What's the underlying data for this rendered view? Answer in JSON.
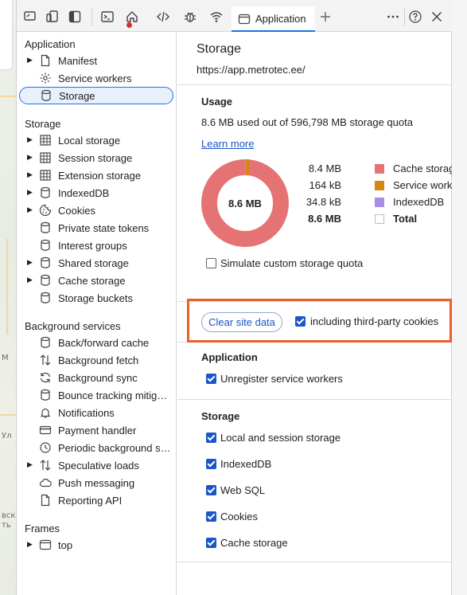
{
  "map": {
    "labels": [
      "M",
      "Ул",
      "вск",
      "ть"
    ]
  },
  "toolbar": {
    "active_tab_label": "Application",
    "icons": [
      "device-toolbar-icon",
      "device-mode-icon",
      "dock-side-icon",
      "console-icon",
      "home-icon",
      "sources-icon",
      "bug-icon",
      "network-icon",
      "application-icon",
      "new-tab-icon",
      "more-icon",
      "help-icon",
      "close-icon"
    ]
  },
  "sidebar": {
    "application_title": "Application",
    "application_items": [
      {
        "label": "Manifest",
        "arrow": "▶",
        "icon": "file-icon"
      },
      {
        "label": "Service workers",
        "arrow": "",
        "icon": "gear-icon"
      },
      {
        "label": "Storage",
        "arrow": "",
        "icon": "database-icon"
      }
    ],
    "storage_title": "Storage",
    "storage_items": [
      {
        "label": "Local storage",
        "arrow": "▶",
        "icon": "grid-icon"
      },
      {
        "label": "Session storage",
        "arrow": "▶",
        "icon": "grid-icon"
      },
      {
        "label": "Extension storage",
        "arrow": "▶",
        "icon": "grid-icon"
      },
      {
        "label": "IndexedDB",
        "arrow": "▶",
        "icon": "database-icon"
      },
      {
        "label": "Cookies",
        "arrow": "▶",
        "icon": "cookie-icon"
      },
      {
        "label": "Private state tokens",
        "arrow": "",
        "icon": "database-icon"
      },
      {
        "label": "Interest groups",
        "arrow": "",
        "icon": "database-icon"
      },
      {
        "label": "Shared storage",
        "arrow": "▶",
        "icon": "database-icon"
      },
      {
        "label": "Cache storage",
        "arrow": "▶",
        "icon": "database-icon"
      },
      {
        "label": "Storage buckets",
        "arrow": "",
        "icon": "database-icon"
      }
    ],
    "background_title": "Background services",
    "background_items": [
      {
        "label": "Back/forward cache",
        "arrow": "",
        "icon": "database-icon"
      },
      {
        "label": "Background fetch",
        "arrow": "",
        "icon": "up-down-arrows-icon"
      },
      {
        "label": "Background sync",
        "arrow": "",
        "icon": "sync-icon"
      },
      {
        "label": "Bounce tracking mitigations",
        "arrow": "",
        "icon": "database-icon"
      },
      {
        "label": "Notifications",
        "arrow": "",
        "icon": "bell-icon"
      },
      {
        "label": "Payment handler",
        "arrow": "",
        "icon": "card-icon"
      },
      {
        "label": "Periodic background sync",
        "arrow": "",
        "icon": "clock-icon"
      },
      {
        "label": "Speculative loads",
        "arrow": "▶",
        "icon": "up-down-arrows-icon"
      },
      {
        "label": "Push messaging",
        "arrow": "",
        "icon": "cloud-icon"
      },
      {
        "label": "Reporting API",
        "arrow": "",
        "icon": "file-icon"
      }
    ],
    "frames_title": "Frames",
    "frames_items": [
      {
        "label": "top",
        "arrow": "▶",
        "icon": "frame-icon"
      }
    ]
  },
  "main": {
    "title": "Storage",
    "origin": "https://app.metrotec.ee/",
    "usage_title": "Usage",
    "usage_text": "8.6 MB used out of 596,798 MB storage quota",
    "learn_more": "Learn more",
    "donut_center": "8.6 MB",
    "legend": [
      {
        "value": "8.4 MB",
        "name": "Cache storage",
        "color": "#e57373",
        "bold": false
      },
      {
        "value": "164 kB",
        "name": "Service workers",
        "color": "#d4880f",
        "bold": false
      },
      {
        "value": "34.8 kB",
        "name": "IndexedDB",
        "color": "#a98ee8",
        "bold": false
      },
      {
        "value": "8.6 MB",
        "name": "Total",
        "color": "#ffffff",
        "bold": true
      }
    ],
    "simulate_label": "Simulate custom storage quota",
    "clear_button": "Clear site data",
    "third_party_label": "including third-party cookies",
    "application_section_title": "Application",
    "unregister_label": "Unregister service workers",
    "storage_section_title": "Storage",
    "storage_checks": [
      "Local and session storage",
      "IndexedDB",
      "Web SQL",
      "Cookies",
      "Cache storage"
    ]
  }
}
